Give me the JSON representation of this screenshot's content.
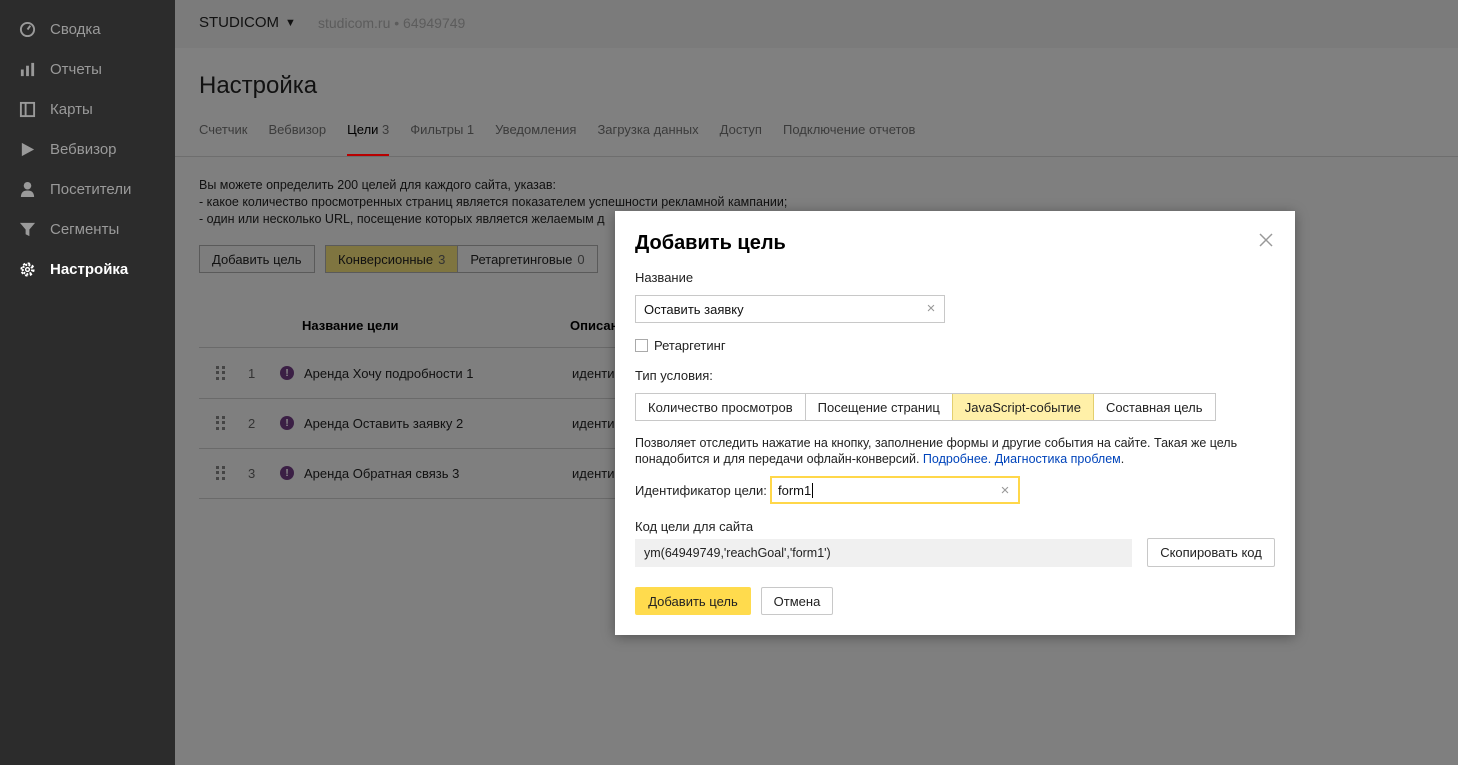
{
  "sidebar": {
    "items": [
      {
        "label": "Сводка",
        "icon": "dashboard-icon"
      },
      {
        "label": "Отчеты",
        "icon": "bar-chart-icon"
      },
      {
        "label": "Карты",
        "icon": "map-icon"
      },
      {
        "label": "Вебвизор",
        "icon": "play-icon"
      },
      {
        "label": "Посетители",
        "icon": "user-icon"
      },
      {
        "label": "Сегменты",
        "icon": "filter-icon"
      },
      {
        "label": "Настройка",
        "icon": "gear-icon",
        "active": true
      }
    ]
  },
  "topbar": {
    "brand": "STUDICOM",
    "site_info": "studicom.ru • 64949749"
  },
  "page": {
    "title": "Настройка",
    "tabs": [
      {
        "label": "Счетчик",
        "count": ""
      },
      {
        "label": "Вебвизор",
        "count": ""
      },
      {
        "label": "Цели",
        "count": "3",
        "active": true
      },
      {
        "label": "Фильтры",
        "count": "1"
      },
      {
        "label": "Уведомления",
        "count": ""
      },
      {
        "label": "Загрузка данных",
        "count": ""
      },
      {
        "label": "Доступ",
        "count": ""
      },
      {
        "label": "Подключение отчетов",
        "count": ""
      }
    ]
  },
  "goals": {
    "description": [
      "Вы можете определить 200 целей для каждого сайта, указав:",
      "- какое количество просмотренных страниц является показателем успешности рекламной кампании;",
      "- один или несколько URL, посещение которых является желаемым д"
    ],
    "add_button": "Добавить цель",
    "filters": [
      {
        "label": "Конверсионные",
        "count": "3"
      },
      {
        "label": "Ретаргетинговые",
        "count": "0"
      }
    ],
    "table": {
      "columns": [
        "Название цели",
        "Описан"
      ],
      "rows": [
        {
          "num": "1",
          "name": "Аренда Хочу подробности 1",
          "desc": "иденти"
        },
        {
          "num": "2",
          "name": "Аренда Оставить заявку 2",
          "desc": "иденти"
        },
        {
          "num": "3",
          "name": "Аренда Обратная связь 3",
          "desc": "иденти"
        }
      ]
    }
  },
  "modal": {
    "title": "Добавить цель",
    "name_label": "Название",
    "name_value": "Оставить заявку",
    "retargeting_label": "Ретаргетинг",
    "condition_label": "Тип условия:",
    "condition_types": [
      "Количество просмотров",
      "Посещение страниц",
      "JavaScript-событие",
      "Составная цель"
    ],
    "hint_text": "Позволяет отследить нажатие на кнопку, заполнение формы и другие события на сайте. Такая же цель понадобится и для передачи офлайн-конверсий. ",
    "hint_link1": "Подробнее.",
    "hint_link2": "Диагностика проблем",
    "hint_end": ".",
    "goal_id_label": "Идентификатор цели:",
    "goal_id_value": "form1",
    "code_label": "Код цели для сайта",
    "code_value": "ym(64949749,'reachGoal','form1')",
    "copy_button": "Скопировать код",
    "submit_button": "Добавить цель",
    "cancel_button": "Отмена"
  }
}
